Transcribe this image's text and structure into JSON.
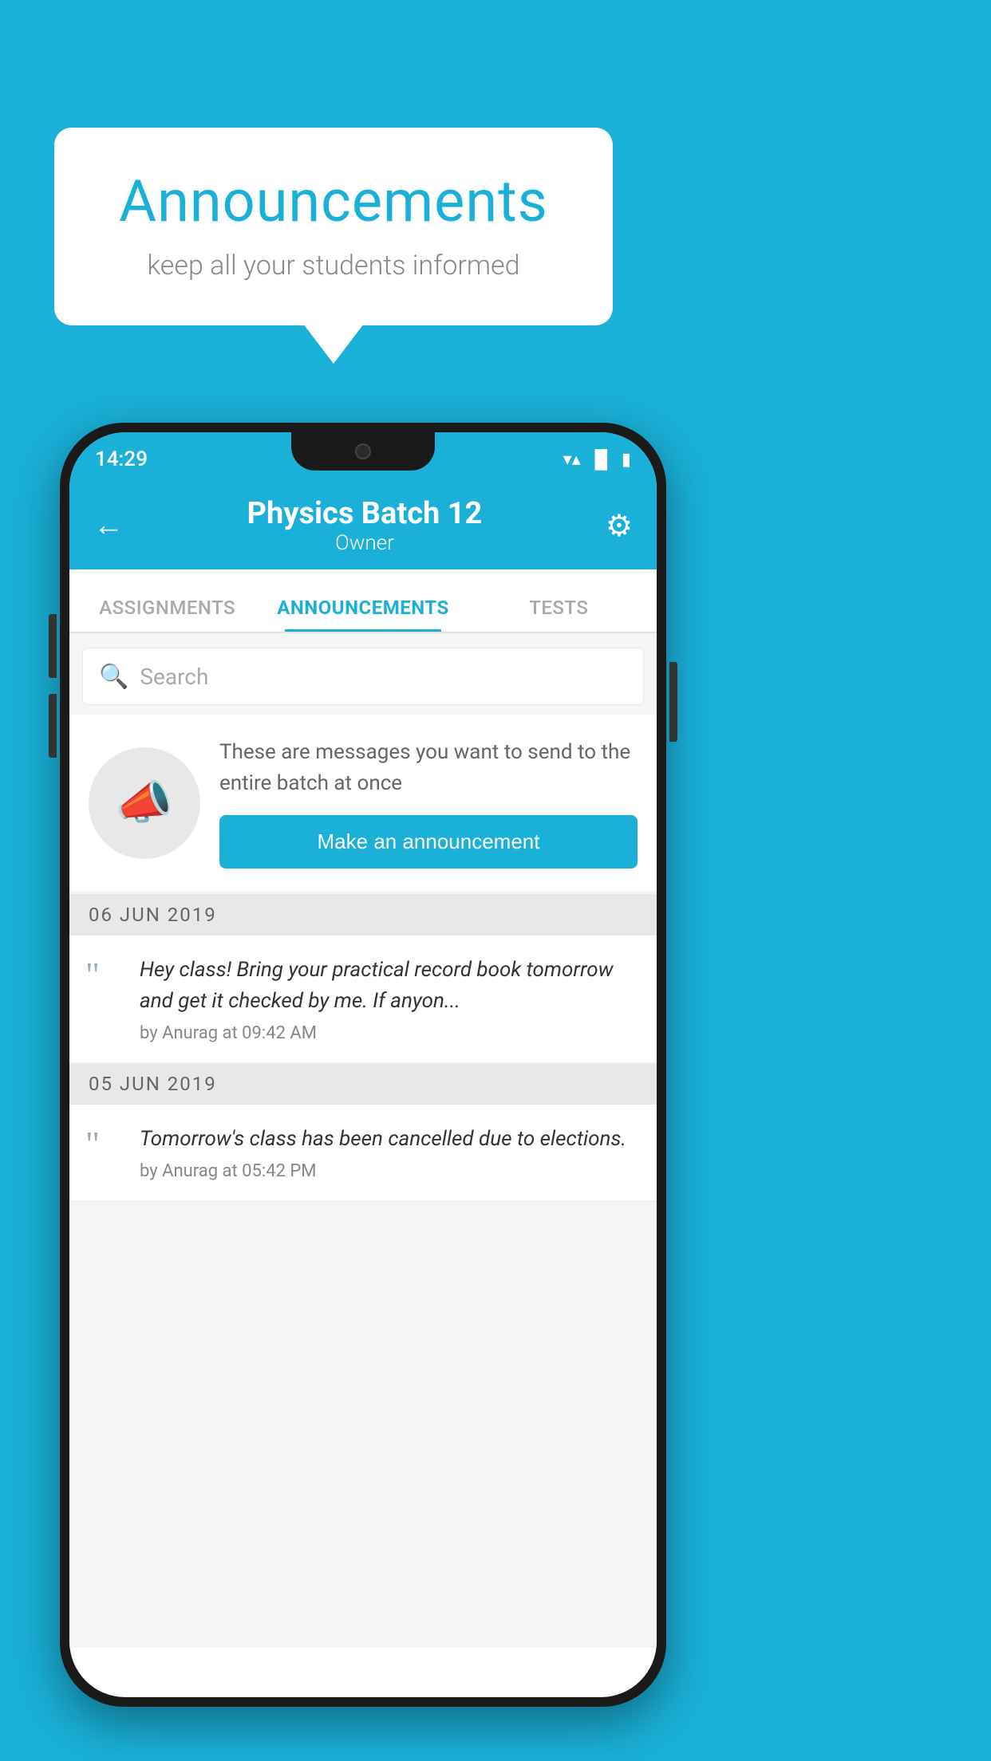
{
  "page": {
    "background_color": "#1ab0d8"
  },
  "bubble": {
    "title": "Announcements",
    "subtitle": "keep all your students informed"
  },
  "phone": {
    "status_bar": {
      "time": "14:29"
    },
    "app_bar": {
      "title": "Physics Batch 12",
      "subtitle": "Owner",
      "back_label": "←",
      "gear_label": "⚙"
    },
    "tabs": [
      {
        "label": "ASSIGNMENTS",
        "active": false
      },
      {
        "label": "ANNOUNCEMENTS",
        "active": true
      },
      {
        "label": "TESTS",
        "active": false
      }
    ],
    "search": {
      "placeholder": "Search"
    },
    "announce_prompt": {
      "description": "These are messages you want to send to the entire batch at once",
      "button_label": "Make an announcement"
    },
    "announcements": [
      {
        "date": "06  JUN  2019",
        "text": "Hey class! Bring your practical record book tomorrow and get it checked by me. If anyon...",
        "by": "by Anurag at 09:42 AM"
      },
      {
        "date": "05  JUN  2019",
        "text": "Tomorrow's class has been cancelled due to elections.",
        "by": "by Anurag at 05:42 PM"
      }
    ]
  }
}
